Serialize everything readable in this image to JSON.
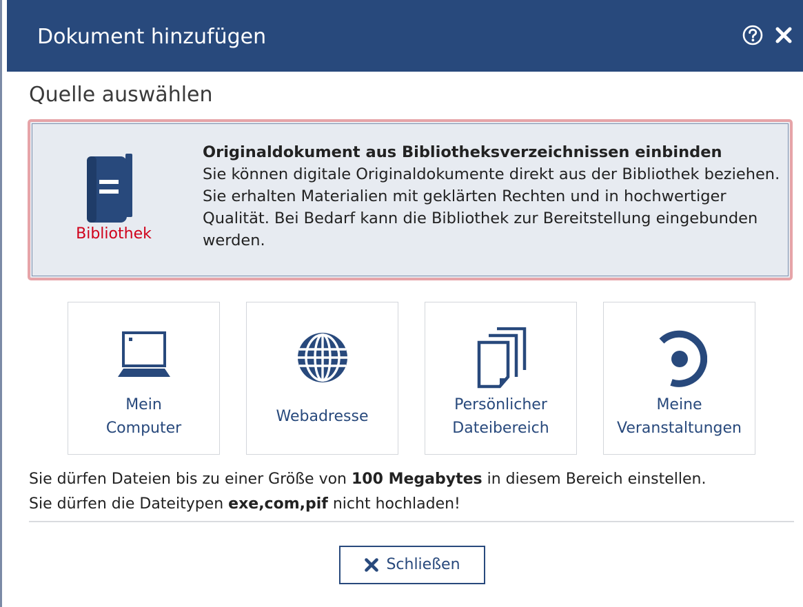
{
  "dialog": {
    "title": "Dokument hinzufügen",
    "help_icon": "help-circle-icon",
    "close_icon": "close-icon"
  },
  "section_title": "Quelle auswählen",
  "library": {
    "label": "Bibliothek",
    "icon": "book-icon",
    "heading": "Originaldokument aus Bibliotheksverzeichnissen einbinden",
    "description": "Sie können digitale Originaldokumente direkt aus der Bibliothek beziehen. Sie erhalten Materialien mit geklärten Rechten und in hochwertiger Qualität. Bei Bedarf kann die Bibliothek zur Bereitstellung eingebunden werden."
  },
  "sources": [
    {
      "label": "Mein\nComputer",
      "icon": "laptop-icon"
    },
    {
      "label": "Webadresse",
      "icon": "globe-icon"
    },
    {
      "label": "Persönlicher\nDateibereich",
      "icon": "documents-icon"
    },
    {
      "label": "Meine\nVeranstaltungen",
      "icon": "courses-icon"
    }
  ],
  "info": {
    "size_prefix": "Sie dürfen Dateien bis zu einer Größe von ",
    "size_value": "100 Megabytes",
    "size_suffix": " in diesem Bereich einstellen.",
    "types_prefix": "Sie dürfen die Dateitypen ",
    "types_value": "exe,com,pif",
    "types_suffix": " nicht hochladen!"
  },
  "close_button": {
    "label": "Schließen",
    "icon": "close-icon"
  },
  "colors": {
    "header": "#28497c",
    "accent_red": "#d0021b",
    "card_border": "#e6a4a8",
    "card_bg": "#e7ebf1"
  }
}
